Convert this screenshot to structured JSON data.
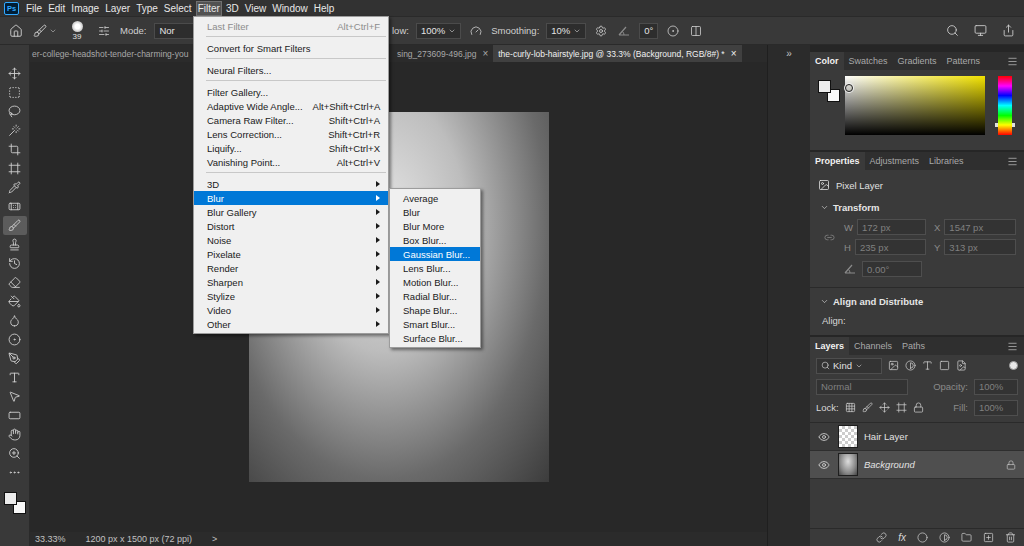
{
  "app": {
    "logo": "Ps"
  },
  "menu_bar": [
    {
      "label": "File",
      "selected": false
    },
    {
      "label": "Edit",
      "selected": false
    },
    {
      "label": "Image",
      "selected": false
    },
    {
      "label": "Layer",
      "selected": false
    },
    {
      "label": "Type",
      "selected": false
    },
    {
      "label": "Select",
      "selected": false
    },
    {
      "label": "Filter",
      "selected": true
    },
    {
      "label": "3D",
      "selected": false
    },
    {
      "label": "View",
      "selected": false
    },
    {
      "label": "Window",
      "selected": false
    },
    {
      "label": "Help",
      "selected": false
    }
  ],
  "options_bar": {
    "brush_size": "39",
    "mode_label": "Mode:",
    "mode_value": "Nor",
    "flow_label": "low:",
    "flow_value": "100%",
    "smoothing_label": "Smoothing:",
    "smoothing_value": "10%",
    "angle_value": "0°"
  },
  "document_tabs": [
    {
      "label": "er-college-headshot-tender-charming-you",
      "selected": false
    },
    {
      "label": "sing_273609-496.jpg",
      "selected": false,
      "close": "×"
    },
    {
      "label": "the-curly-lob-hairstyle.jpg @ 33.3% (Background, RGB/8#) *",
      "selected": true,
      "close": "×"
    }
  ],
  "panel_toggle": "»",
  "tools": [
    {
      "selected": false
    },
    {
      "selected": false
    },
    {
      "selected": false
    },
    {
      "selected": false
    },
    {
      "selected": false
    },
    {
      "selected": false
    },
    {
      "selected": false
    },
    {
      "selected": false
    },
    {
      "selected": true
    },
    {
      "selected": false
    },
    {
      "selected": false
    },
    {
      "selected": false
    },
    {
      "selected": false
    },
    {
      "selected": false
    },
    {
      "selected": false
    },
    {
      "selected": false
    },
    {
      "selected": false
    },
    {
      "selected": false
    },
    {
      "selected": false
    },
    {
      "selected": false
    },
    {
      "selected": false
    },
    {
      "selected": false
    }
  ],
  "filter_menu": [
    {
      "kind": "item",
      "label": "Last Filter",
      "shortcut": "Alt+Ctrl+F",
      "disabled": true,
      "selected": false
    },
    {
      "kind": "separator"
    },
    {
      "kind": "item",
      "label": "Convert for Smart Filters",
      "disabled": false,
      "selected": false
    },
    {
      "kind": "separator"
    },
    {
      "kind": "item",
      "label": "Neural Filters...",
      "disabled": false,
      "selected": false
    },
    {
      "kind": "separator"
    },
    {
      "kind": "item",
      "label": "Filter Gallery...",
      "disabled": false,
      "selected": false
    },
    {
      "kind": "item",
      "label": "Adaptive Wide Angle...",
      "shortcut": "Alt+Shift+Ctrl+A",
      "disabled": false,
      "selected": false
    },
    {
      "kind": "item",
      "label": "Camera Raw Filter...",
      "shortcut": "Shift+Ctrl+A",
      "disabled": false,
      "selected": false
    },
    {
      "kind": "item",
      "label": "Lens Correction...",
      "shortcut": "Shift+Ctrl+R",
      "disabled": false,
      "selected": false
    },
    {
      "kind": "item",
      "label": "Liquify...",
      "shortcut": "Shift+Ctrl+X",
      "disabled": false,
      "selected": false
    },
    {
      "kind": "item",
      "label": "Vanishing Point...",
      "shortcut": "Alt+Ctrl+V",
      "disabled": false,
      "selected": false
    },
    {
      "kind": "separator"
    },
    {
      "kind": "submenu",
      "label": "3D",
      "disabled": false,
      "selected": false
    },
    {
      "kind": "submenu",
      "label": "Blur",
      "disabled": false,
      "selected": true,
      "children": [
        {
          "label": "Average",
          "selected": false
        },
        {
          "label": "Blur",
          "selected": false
        },
        {
          "label": "Blur More",
          "selected": false
        },
        {
          "label": "Box Blur...",
          "selected": false
        },
        {
          "label": "Gaussian Blur...",
          "selected": true
        },
        {
          "label": "Lens Blur...",
          "selected": false
        },
        {
          "label": "Motion Blur...",
          "selected": false
        },
        {
          "label": "Radial Blur...",
          "selected": false
        },
        {
          "label": "Shape Blur...",
          "selected": false
        },
        {
          "label": "Smart Blur...",
          "selected": false
        },
        {
          "label": "Surface Blur...",
          "selected": false
        }
      ]
    },
    {
      "kind": "submenu",
      "label": "Blur Gallery",
      "disabled": false,
      "selected": false
    },
    {
      "kind": "submenu",
      "label": "Distort",
      "disabled": false,
      "selected": false
    },
    {
      "kind": "submenu",
      "label": "Noise",
      "disabled": false,
      "selected": false
    },
    {
      "kind": "submenu",
      "label": "Pixelate",
      "disabled": false,
      "selected": false
    },
    {
      "kind": "submenu",
      "label": "Render",
      "disabled": false,
      "selected": false
    },
    {
      "kind": "submenu",
      "label": "Sharpen",
      "disabled": false,
      "selected": false
    },
    {
      "kind": "submenu",
      "label": "Stylize",
      "disabled": false,
      "selected": false
    },
    {
      "kind": "submenu",
      "label": "Video",
      "disabled": false,
      "selected": false
    },
    {
      "kind": "submenu",
      "label": "Other",
      "disabled": false,
      "selected": false
    }
  ],
  "status_bar": {
    "zoom": "33.33%",
    "document_size": "1200 px x 1500 px (72 ppi)",
    "more": ">"
  },
  "color_panel": {
    "tabs": [
      {
        "label": "Color",
        "selected": true
      },
      {
        "label": "Swatches",
        "selected": false
      },
      {
        "label": "Gradients",
        "selected": false
      },
      {
        "label": "Patterns",
        "selected": false
      }
    ]
  },
  "properties_panel": {
    "tabs": [
      {
        "label": "Properties",
        "selected": true
      },
      {
        "label": "Adjustments",
        "selected": false
      },
      {
        "label": "Libraries",
        "selected": false
      }
    ],
    "layer_kind": "Pixel Layer",
    "transform": {
      "title": "Transform",
      "expanded": true,
      "disabled": true,
      "fields": [
        {
          "label": "W",
          "value": "172 px"
        },
        {
          "label": "X",
          "value": "1547 px"
        },
        {
          "label": "H",
          "value": "235 px"
        },
        {
          "label": "Y",
          "value": "313 px"
        }
      ],
      "angle": "0.00°"
    },
    "align": {
      "title": "Align and Distribute",
      "expanded": true,
      "label": "Align:"
    }
  },
  "layers_panel": {
    "tabs": [
      {
        "label": "Layers",
        "selected": true
      },
      {
        "label": "Channels",
        "selected": false
      },
      {
        "label": "Paths",
        "selected": false
      }
    ],
    "filter": "Kind",
    "filter_toggle_on": true,
    "controls_disabled": true,
    "blend_mode": "Normal",
    "opacity_label": "Opacity:",
    "opacity": "100%",
    "lock_label": "Lock:",
    "fill_label": "Fill:",
    "fill": "100%",
    "effects_button": "fx",
    "layers": [
      {
        "name": "Hair Layer",
        "visible": true,
        "selected": false,
        "locked": false,
        "kind": "transparent"
      },
      {
        "name": "Background",
        "visible": true,
        "selected": true,
        "locked": true,
        "kind": "background"
      }
    ]
  }
}
